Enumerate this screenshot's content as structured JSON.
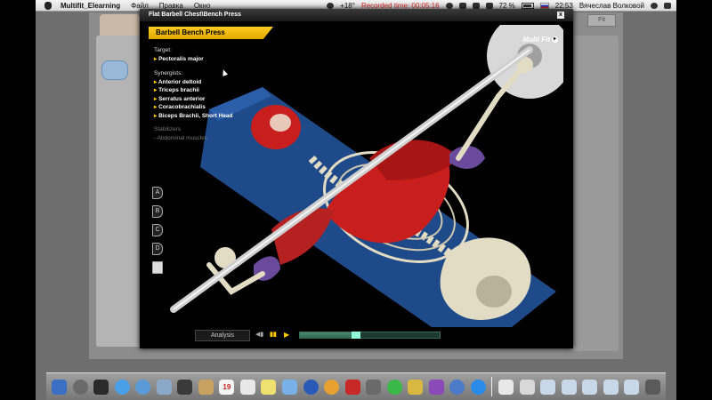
{
  "menubar": {
    "app_name": "Multifit_Elearning",
    "menus": [
      "Файл",
      "Правка",
      "Окно"
    ],
    "temperature": "+18°",
    "recorded": "Recorded time: 00:05:16",
    "battery": "72 %",
    "clock": "22:53",
    "user": "Вячеслав Волковой"
  },
  "window": {
    "title": "Flat Barbell Chest\\Bench Press",
    "close": "x"
  },
  "exercise": {
    "banner": "Barbell Bench Press",
    "logo": "Multi Fit",
    "target_label": "Target:",
    "target": "Pectoralis major",
    "synergists_label": "Synergists:",
    "synergists": [
      "Anterior deltoid",
      "Triceps brachii",
      "Serratus anterior",
      "Coracobrachialis",
      "Biceps Brachii, Short Head"
    ],
    "stabilizers_label": "Stabilizers",
    "stabilizers": [
      "- Abdominal muscles"
    ]
  },
  "side_buttons": [
    "A",
    "B",
    "C",
    "D"
  ],
  "controls": {
    "analysis": "Analysis",
    "progress": 0.4
  },
  "background": {
    "tab_right": "Fit"
  },
  "colors": {
    "banner": "#ffcc22",
    "muscle": "#c81e1e",
    "bench": "#1f4a8a",
    "bone": "#e2dcc4"
  }
}
